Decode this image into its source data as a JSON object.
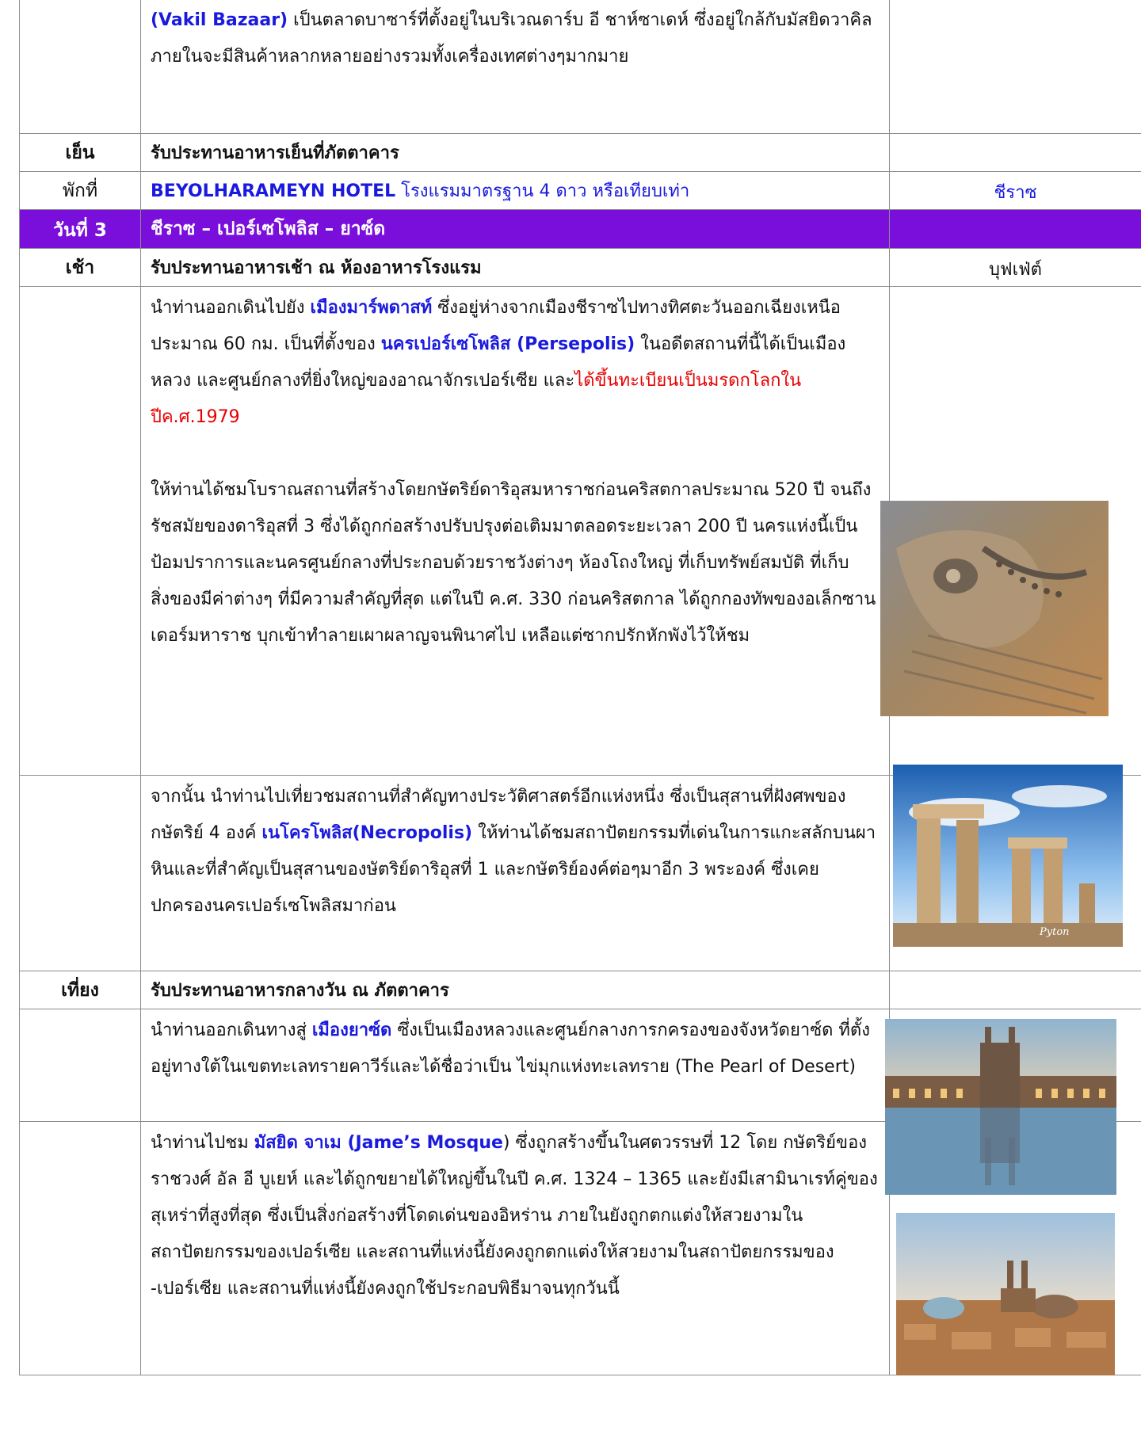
{
  "row_intro": {
    "place": "(Vakil  Bazaar)",
    "text_after": " เป็นตลาดบาซาร์ที่ตั้งอยู่ในบริเวณดาร์บ อี ชาห์ซาเดห์ ซึ่งอยู่ใกล้กับมัสยิดวาคิล ภายในจะมีสินค้าหลากหลายอย่างรวมทั้งเครื่องเทศต่างๆมากมาย"
  },
  "row_dinner": {
    "time": "เย็น",
    "text": "รับประทานอาหารเย็นที่ภัตตาคาร"
  },
  "row_hotel": {
    "time": "พักที่",
    "hotel": "BEYOLHARAMEYN  HOTEL",
    "hotel_desc": " โรงแรมมาตรฐาน 4 ดาว หรือเทียบเท่า",
    "city": "ชีราซ"
  },
  "day3": {
    "label": "วันที่ 3",
    "route": "ชีราซ – เปอร์เซโพลิส – ยาซ์ด"
  },
  "row_breakfast": {
    "time": "เช้า",
    "text": "รับประทานอาหารเช้า ณ ห้องอาหารโรงแรม",
    "meal": "บุฟเฟ่ต์"
  },
  "row_persepolis": {
    "t1": "นำท่านออกเดินไปยัง ",
    "b1": "เมืองมาร์พดาสท์",
    "t2": " ซึ่งอยู่ห่างจากเมืองชีราซไปทางทิศตะวันออกเฉียงเหนือประมาณ 60 กม. เป็นที่ตั้งของ ",
    "b2": "นครเปอร์เซโพลิส (Persepolis)",
    "t3": " ในอดีตสถานที่นี้ได้เป็นเมืองหลวง และศูนย์กลางที่ยิ่งใหญ่ของอาณาจักรเปอร์เซีย และ",
    "r1": "ได้ขึ้นทะเบียนเป็นมรดกโลกในปีค.ศ.1979",
    "p2": "ให้ท่านได้ชมโบราณสถานที่สร้างโดยกษัตริย์ดาริอุสมหาราชก่อนคริสตกาลประมาณ 520 ปี จนถึงรัชสมัยของดาริอุสที่ 3 ซึ่งได้ถูกก่อสร้างปรับปรุงต่อเติมมาตลอดระยะเวลา 200 ปี นครแห่งนี้เป็นป้อมปราการและนครศูนย์กลางที่ประกอบด้วยราชวังต่างๆ ห้องโถงใหญ่ ที่เก็บทรัพย์สมบัติ ที่เก็บสิ่งของมีค่าต่างๆ ที่มีความสำคัญที่สุด แต่ในปี ค.ศ. 330 ก่อนคริสตกาล ได้ถูกกองทัพของอเล็กซานเดอร์มหาราช บุกเข้าทำลายเผาผลาญจนพินาศไป เหลือแต่ซากปรักหักพังไว้ให้ชม"
  },
  "row_necropolis": {
    "t1": "จากนั้น นำท่านไปเที่ยวชมสถานที่สำคัญทางประวัติศาสตร์อีกแห่งหนึ่ง ซึ่งเป็นสุสานที่ฝังศพของกษัตริย์ 4 องค์ ",
    "b1": "เนโครโพลิส(Necropolis)",
    "t2": "  ให้ท่านได้ชมสถาปัตยกรรมที่เด่นในการแกะสลักบนผาหินและที่สำคัญเป็นสุสานของษัตริย์ดาริอุสที่ 1 และกษัตริย์องค์ต่อๆมาอีก 3 พระองค์ ซึ่งเคยปกครองนครเปอร์เซโพลิสมาก่อน",
    "watermark": "Pyton"
  },
  "row_lunch": {
    "time": "เที่ยง",
    "text": "รับประทานอาหารกลางวัน ณ ภัตตาคาร"
  },
  "row_yazd": {
    "t1": "นำท่านออกเดินทางสู่ ",
    "b1": "เมืองยาซ์ด",
    "t2": " ซึ่งเป็นเมืองหลวงและศูนย์กลางการกครองของจังหวัดยาซ์ด ที่ตั้งอยู่ทางใต้ในเขตทะเลทรายคาวีร์และได้ชื่อว่าเป็น ไข่มุกแห่งทะเลทราย (The Pearl of Desert)"
  },
  "row_mosque": {
    "t1": "นำท่านไปชม ",
    "b1": "มัสยิด จาเม (Jame’s Mosque",
    "t2": ") ซึ่งถูกสร้างขึ้นในศตวรรษที่ 12 โดย กษัตริย์ของราชวงศ์ อัล อี บูเยห์ และได้ถูกขยายได้ใหญ่ขึ้นในปี ค.ศ. 1324 – 1365 และยังมีเสามินาเรท์คู่ของสุเหร่าที่สูงที่สุด ซึ่งเป็นสิ่งก่อสร้างที่โดดเด่นของอิหร่าน ภายในยังถูกตกแต่งให้สวยงามในสถาปัตยกรรมของเปอร์เซีย และสถานที่แห่งนี้ยังคงถูกตกแต่งให้สวยงามในสถาปัตยกรรมของ -เปอร์เซีย และสถานที่แห่งนี้ยังคงถูกใช้ประกอบพิธีมาจนทุกวันนี้"
  },
  "colors": {
    "day_header": "#7a0edb",
    "highlight": "#1a1adf",
    "heritage": "#e60000"
  }
}
